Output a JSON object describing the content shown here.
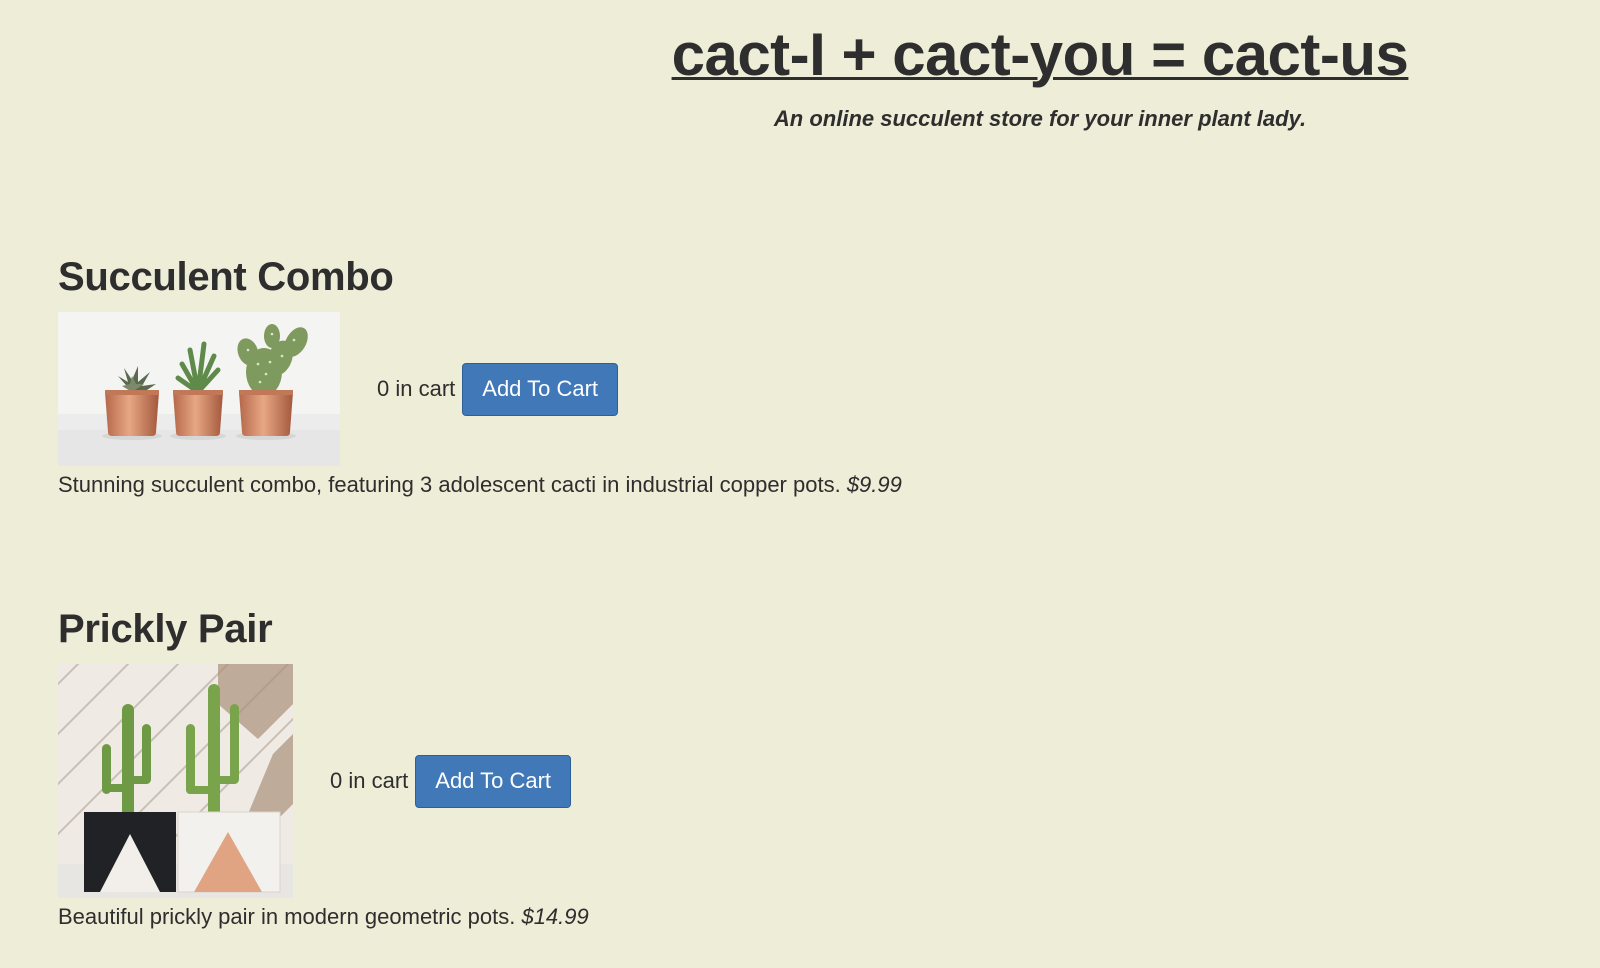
{
  "header": {
    "title": "cact-I + cact-you = cact-us",
    "tagline": "An online succulent store for your inner plant lady."
  },
  "products": [
    {
      "name": "Succulent Combo",
      "cart_count": "0 in cart",
      "button_label": "Add To Cart",
      "description": "Stunning succulent combo, featuring 3 adolescent cacti in industrial copper pots.",
      "price": "$9.99"
    },
    {
      "name": "Prickly Pair",
      "cart_count": "0 in cart",
      "button_label": "Add To Cart",
      "description": "Beautiful prickly pair in modern geometric pots.",
      "price": "$14.99"
    }
  ],
  "colors": {
    "background": "#ededd8",
    "button": "#4078b8",
    "text": "#2e2e2e"
  }
}
